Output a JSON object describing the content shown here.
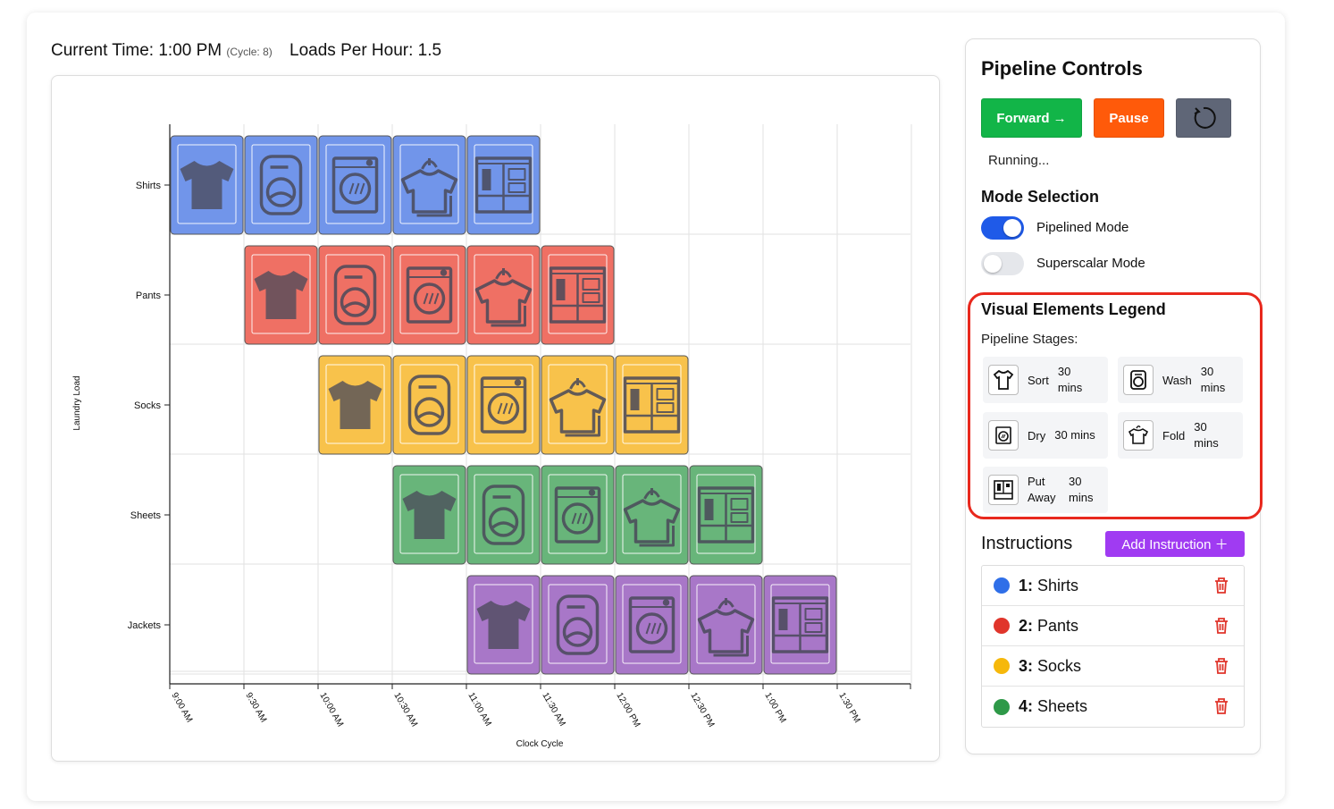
{
  "header": {
    "current_time_label": "Current Time: 1:00 PM",
    "cycle_label": "(Cycle: 8)",
    "loads_per_hour_label": "Loads Per Hour: 1.5"
  },
  "chart_data": {
    "type": "gantt",
    "xlabel": "Clock Cycle",
    "ylabel": "Laundry Load",
    "x_ticks": [
      "9:00 AM",
      "9:30 AM",
      "10:00 AM",
      "10:30 AM",
      "11:00 AM",
      "11:30 AM",
      "12:00 PM",
      "12:30 PM",
      "1:00 PM",
      "1:30 PM"
    ],
    "stages": [
      "sort",
      "wash",
      "dry",
      "fold",
      "put-away"
    ],
    "series": [
      {
        "name": "Shirts",
        "color": "#7195ea",
        "start_cycle": 0
      },
      {
        "name": "Pants",
        "color": "#ef7064",
        "start_cycle": 1
      },
      {
        "name": "Socks",
        "color": "#f8c24b",
        "start_cycle": 2
      },
      {
        "name": "Sheets",
        "color": "#68b57a",
        "start_cycle": 3
      },
      {
        "name": "Jackets",
        "color": "#a877c8",
        "start_cycle": 4
      }
    ]
  },
  "controls": {
    "title": "Pipeline Controls",
    "forward_label": "Forward →",
    "pause_label": "Pause",
    "reset_icon": "rotate-ccw-icon",
    "status": "Running..."
  },
  "mode": {
    "title": "Mode Selection",
    "pipelined_label": "Pipelined Mode",
    "pipelined_on": true,
    "superscalar_label": "Superscalar Mode",
    "superscalar_on": false
  },
  "legend": {
    "title": "Visual Elements Legend",
    "subtitle": "Pipeline Stages:",
    "items": [
      {
        "name": "Sort",
        "duration": "30 mins",
        "icon": "shirt-icon"
      },
      {
        "name": "Wash",
        "duration": "30 mins",
        "icon": "washer-icon"
      },
      {
        "name": "Dry",
        "duration": "30 mins",
        "icon": "dryer-icon"
      },
      {
        "name": "Fold",
        "duration": "30 mins",
        "icon": "folded-shirt-icon"
      },
      {
        "name": "Put Away",
        "duration": "30 mins",
        "icon": "wardrobe-icon"
      }
    ]
  },
  "instructions": {
    "title": "Instructions",
    "add_label": "Add Instruction ＋",
    "items": [
      {
        "num": "1:",
        "name": "Shirts",
        "color": "#2f6fe8"
      },
      {
        "num": "2:",
        "name": "Pants",
        "color": "#e0352b"
      },
      {
        "num": "3:",
        "name": "Socks",
        "color": "#f6b80b"
      },
      {
        "num": "4:",
        "name": "Sheets",
        "color": "#2e9948"
      }
    ]
  }
}
